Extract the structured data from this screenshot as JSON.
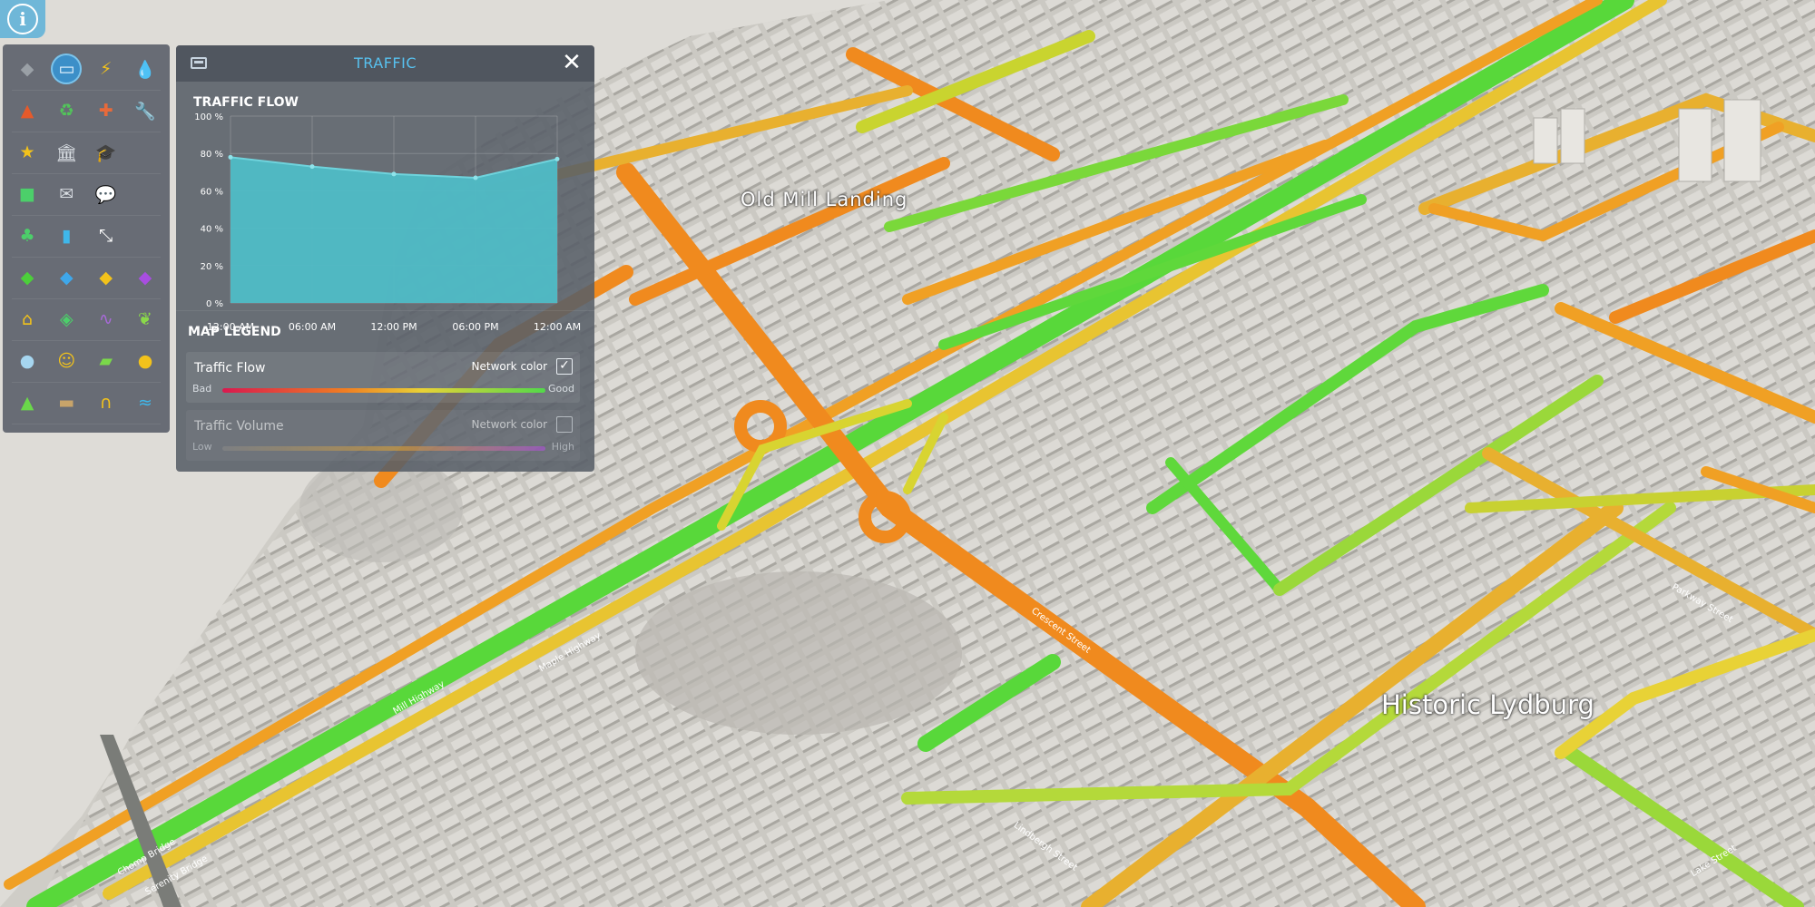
{
  "map": {
    "district_labels": [
      "Old Mill Landing",
      "Historic Lydburg"
    ],
    "street_labels": [
      "Mill Highway",
      "Maple Highway",
      "Crescent Street",
      "Lindbergh Street",
      "Chomp Bridge",
      "Serenity Bridge",
      "Lake Street",
      "Parkway Street"
    ]
  },
  "info_button": {
    "icon": "info-icon"
  },
  "toolbar": {
    "active_tool": "traffic-icon",
    "rows": [
      [
        "road-icon",
        "traffic-icon",
        "electricity-icon",
        "water-icon"
      ],
      [
        "fire-icon",
        "recycle-icon",
        "health-icon",
        "wrench-icon"
      ],
      [
        "police-icon",
        "museum-icon",
        "education-icon",
        ""
      ],
      [
        "bus-icon",
        "mail-icon",
        "chat-icon",
        ""
      ],
      [
        "park-icon",
        "trash-icon",
        "transfer-icon",
        ""
      ],
      [
        "residential-zone-icon",
        "commercial-zone-icon",
        "office-zone-icon",
        "industrial-zone-icon"
      ],
      [
        "house-icon",
        "land-value-icon",
        "pollution-icon",
        "nature-icon"
      ],
      [
        "citizen-icon",
        "happiness-icon",
        "money-icon",
        "worker-icon"
      ],
      [
        "terrain-icon",
        "soil-icon",
        "noise-icon",
        "groundwater-icon"
      ]
    ]
  },
  "panel": {
    "title": "TRAFFIC",
    "header_icon": "traffic-icon",
    "close_icon": "close-icon",
    "traffic_flow": {
      "title": "TRAFFIC FLOW"
    },
    "map_legend": {
      "title": "MAP LEGEND",
      "rows": [
        {
          "label": "Traffic Flow",
          "checkbox_label": "Network color",
          "checked": true,
          "low": "Bad",
          "high": "Good"
        },
        {
          "label": "Traffic Volume",
          "checkbox_label": "Network color",
          "checked": false,
          "low": "Low",
          "high": "High"
        }
      ]
    }
  },
  "chart_data": {
    "type": "area",
    "title": "TRAFFIC FLOW",
    "x": [
      "12:00 AM",
      "06:00 AM",
      "12:00 PM",
      "06:00 PM",
      "12:00 AM"
    ],
    "values": [
      78,
      73,
      69,
      67,
      77
    ],
    "y_ticks": [
      "0 %",
      "20 %",
      "40 %",
      "60 %",
      "80 %",
      "100 %"
    ],
    "ylim": [
      0,
      100
    ],
    "grid": true,
    "color": "#4fbcc6"
  },
  "colors": {
    "road_good": "#58d83a",
    "road_mid": "#d8d431",
    "road_bad": "#f08a1e",
    "accent": "#57c1ef",
    "flow_gradient": [
      "#d9194f",
      "#f07e22",
      "#e8d236",
      "#52d94a"
    ],
    "volume_gradient": [
      "#8c8c8c",
      "#e0a438",
      "#b455e0"
    ]
  }
}
